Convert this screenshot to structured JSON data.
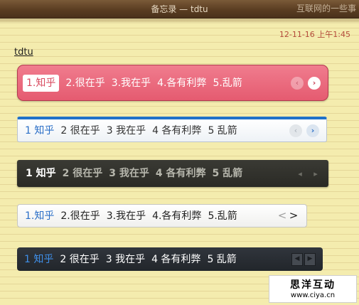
{
  "window": {
    "title": "备忘录 — tdtu",
    "watermark": "互联网的一些事"
  },
  "note": {
    "timestamp": "12-11-16 上午1:45",
    "title": "tdtu"
  },
  "bars": [
    {
      "style": "red",
      "items": [
        "1.知乎",
        "2.很在乎",
        "3.我在乎",
        "4.各有利弊",
        "5.乱箭"
      ],
      "active_index": 0,
      "prev_icon": "‹",
      "next_icon": "›"
    },
    {
      "style": "light-blue",
      "items": [
        "1 知乎",
        "2 很在乎",
        "3 我在乎",
        "4 各有利弊",
        "5 乱箭"
      ],
      "active_index": 0,
      "prev_icon": "‹",
      "next_icon": "›"
    },
    {
      "style": "dark",
      "items": [
        "1 知乎",
        "2 很在乎",
        "3 我在乎",
        "4 各有利弊",
        "5 乱箭"
      ],
      "active_index": 0,
      "prev_icon": "◂",
      "next_icon": "▸"
    },
    {
      "style": "white",
      "items": [
        "1.知乎",
        "2.很在乎",
        "3.我在乎",
        "4.各有利弊",
        "5.乱箭"
      ],
      "active_index": 0,
      "prev_icon": "<",
      "next_icon": ">"
    },
    {
      "style": "dark-slate",
      "items": [
        "1 知乎",
        "2 很在乎",
        "3 我在乎",
        "4 各有利弊",
        "5 乱箭"
      ],
      "active_index": 0,
      "prev_icon": "◀",
      "next_icon": "▶"
    }
  ],
  "brand": {
    "name": "思洋互动",
    "url": "www.ciya.cn"
  }
}
